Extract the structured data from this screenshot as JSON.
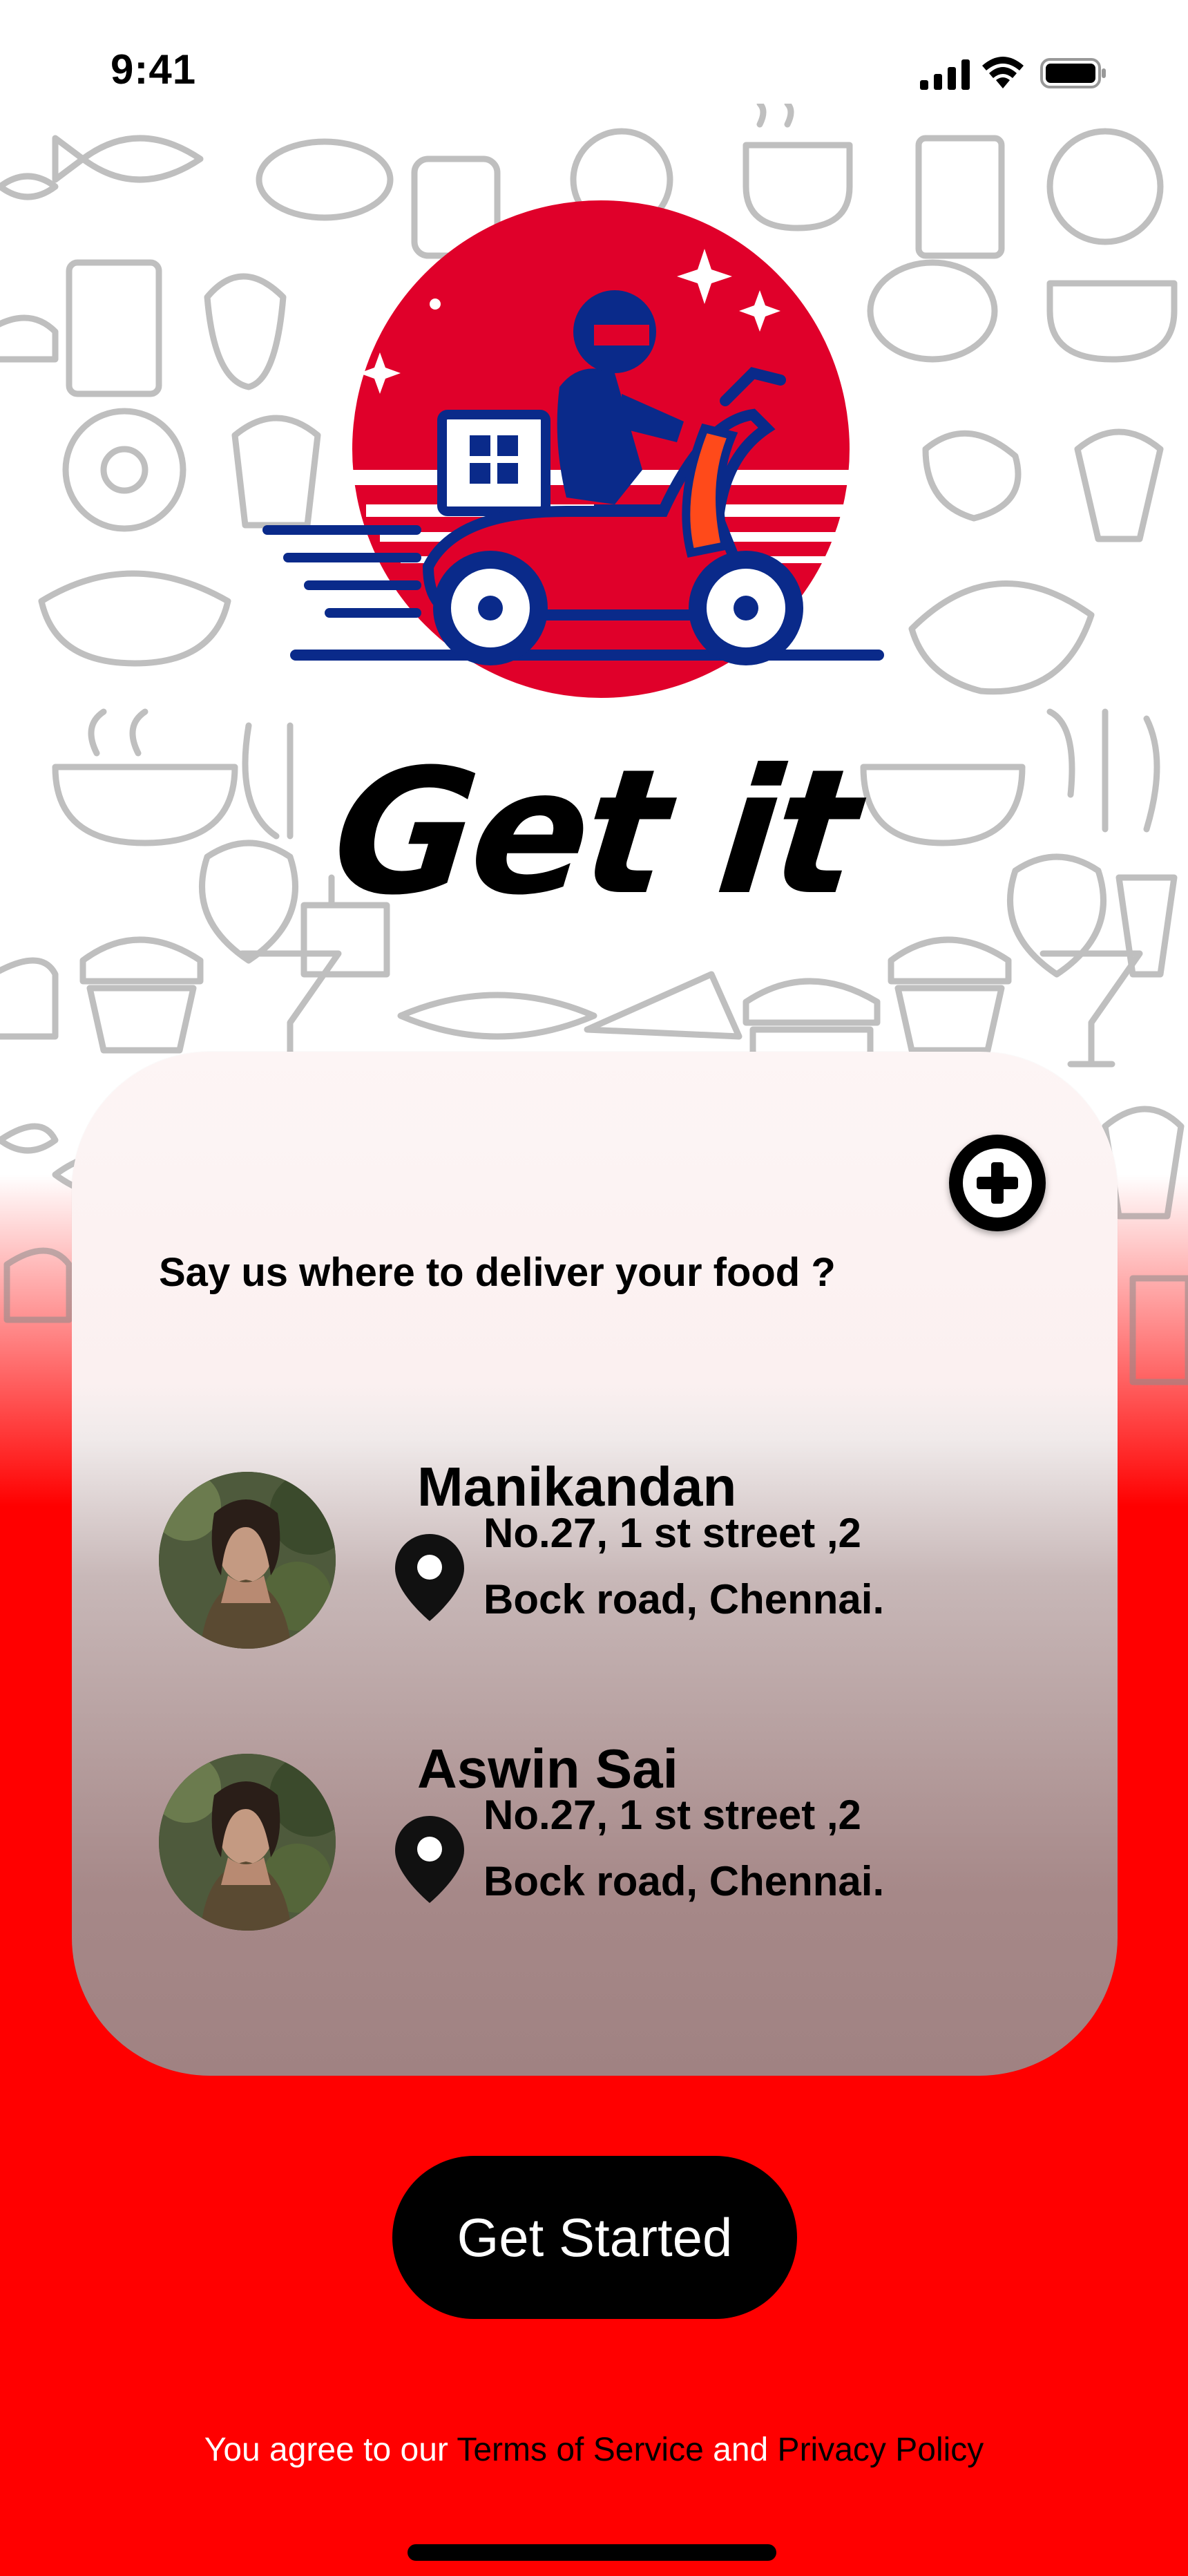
{
  "status_bar": {
    "time": "9:41"
  },
  "brand": {
    "name": "Get it",
    "logo_icon": "scooter-delivery-rider-icon"
  },
  "card": {
    "question": "Say us where to deliver your food ?",
    "add_icon": "plus-circle-icon",
    "addresses": [
      {
        "name": "Manikandan",
        "line1": "No.27, 1 st street ,2",
        "line2": "Bock road, Chennai."
      },
      {
        "name": "Aswin Sai",
        "line1": "No.27, 1 st street ,2",
        "line2": "Bock road, Chennai."
      }
    ]
  },
  "cta": {
    "label": "Get Started"
  },
  "legal": {
    "prefix": "You agree to our ",
    "terms": "Terms of Service",
    "middle": " and ",
    "privacy": "Privacy Policy"
  },
  "colors": {
    "brand_red": "#ff0000",
    "logo_red": "#e0002a",
    "logo_blue": "#0a2a8a",
    "accent_orange": "#ff4a1a",
    "black": "#000000"
  }
}
